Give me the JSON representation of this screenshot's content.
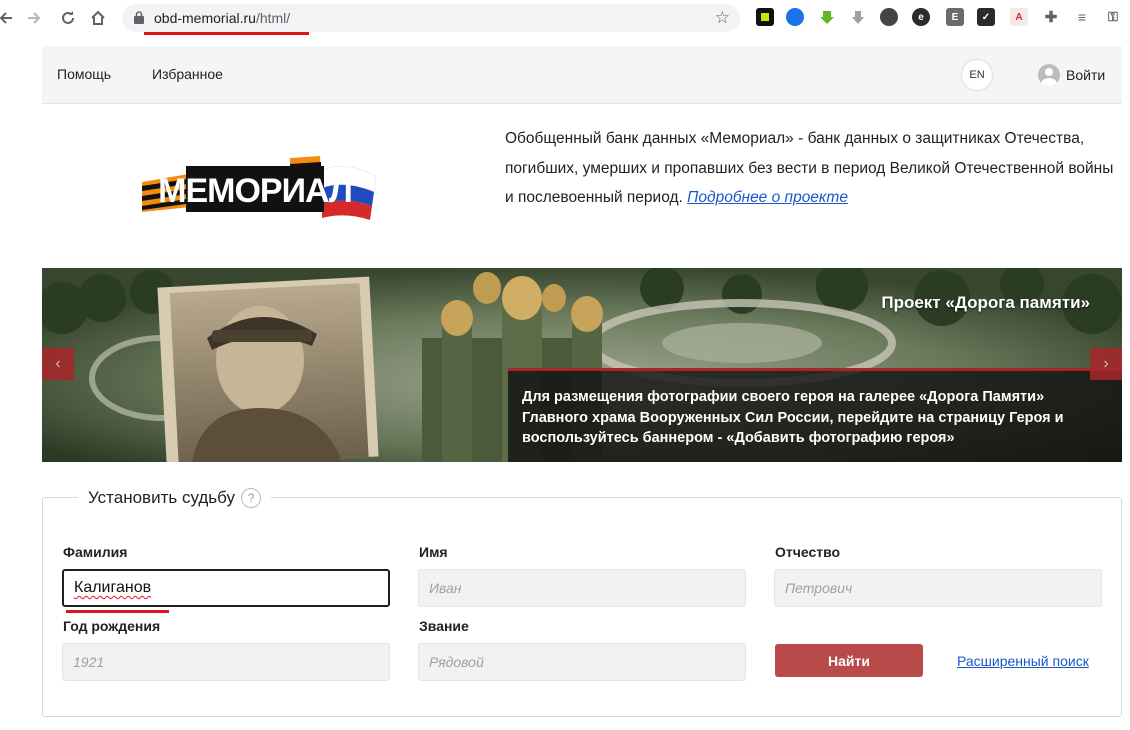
{
  "browser": {
    "url_host": "obd-memorial.ru",
    "url_path": "/html/",
    "icons": [
      "back-icon",
      "forward-icon",
      "reload-icon",
      "home-icon",
      "lock-icon",
      "star-icon"
    ]
  },
  "topbar": {
    "help": "Помощь",
    "favorites": "Избранное",
    "lang": "EN",
    "login": "Войти"
  },
  "intro": {
    "text": "Обобщенный банк данных «Мемориал» - банк данных о защитниках Отечества, погибших, умерших и пропавших без вести в период Великой Отечественной войны и послевоенный период.",
    "link": "Подробнее о проекте"
  },
  "banner": {
    "title": "Проект «Дорога памяти»",
    "text": "Для размещения фотографии своего героя на галерее «Дорога Памяти» Главного храма Вооруженных Сил России, перейдите на страницу Героя и воспользуйтесь баннером - «Добавить фотографию героя»"
  },
  "search": {
    "legend": "Установить судьбу",
    "help_mark": "?",
    "surname_label": "Фамилия",
    "surname_value": "Калиганов",
    "name_label": "Имя",
    "name_placeholder": "Иван",
    "patronymic_label": "Отчество",
    "patronymic_placeholder": "Петрович",
    "birth_label": "Год рождения",
    "birth_placeholder": "1921",
    "rank_label": "Звание",
    "rank_placeholder": "Рядовой",
    "submit": "Найти",
    "advanced": "Расширенный поиск"
  },
  "colors": {
    "accent": "#a8262a",
    "button": "#b84a4a",
    "link": "#1a57c7",
    "highlight": "#e0141e"
  }
}
